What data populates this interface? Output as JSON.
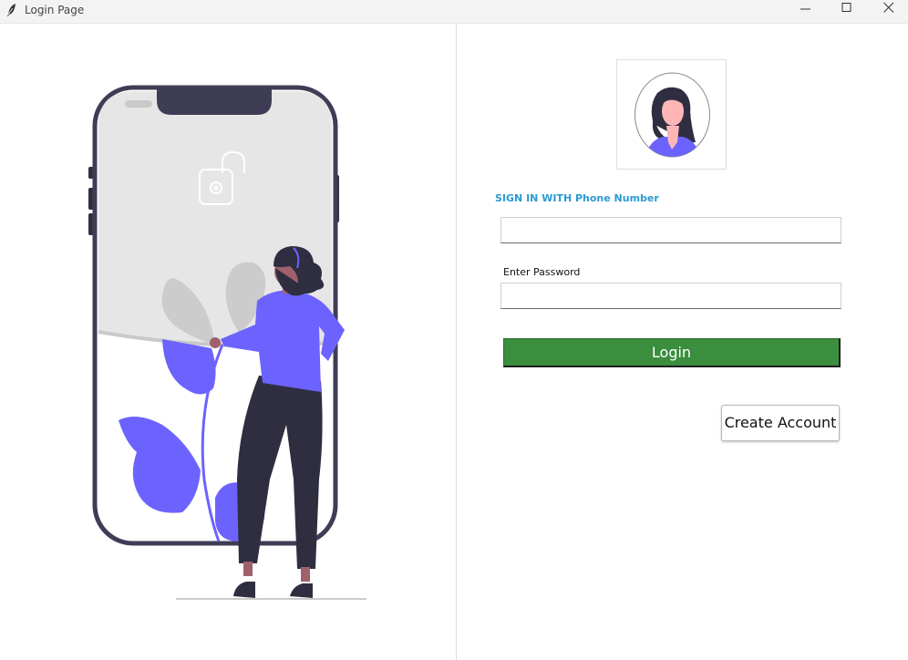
{
  "window": {
    "title": "Login Page",
    "app_icon": "feather-icon",
    "controls": [
      "minimize-icon",
      "maximize-icon",
      "close-icon"
    ]
  },
  "illustration": {
    "description_icon": "phone-unlock-illustration",
    "colors": {
      "accent": "#6c63ff",
      "dark": "#2f2e41",
      "screen": "#e6e6e6"
    }
  },
  "form": {
    "avatar_icon": "user-avatar-icon",
    "sign_in_label": "SIGN IN WITH Phone Number",
    "phone_value": "",
    "password_label": "Enter Password",
    "password_value": "",
    "login_label": "Login",
    "create_account_label": "Create Account",
    "colors": {
      "sign_in_label": "#2b9ad3",
      "login_button": "#3a8e3e"
    }
  }
}
